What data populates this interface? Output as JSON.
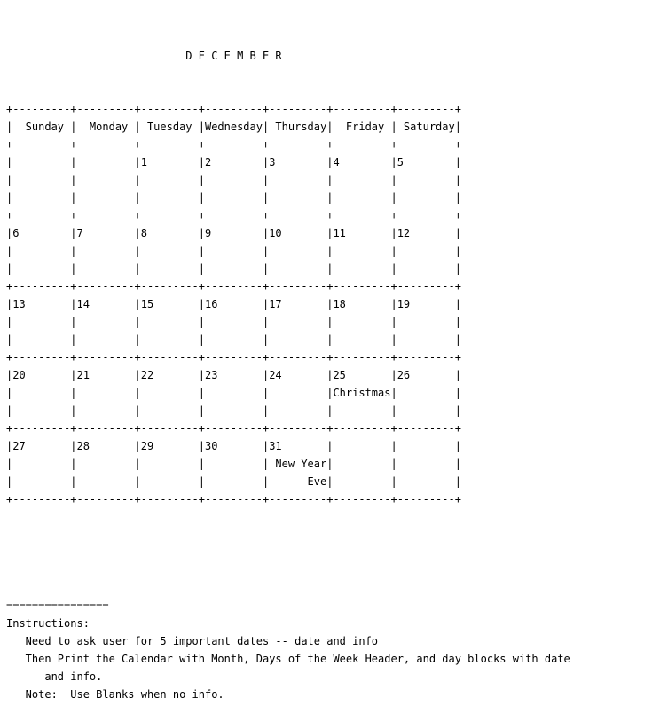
{
  "meta": {
    "output_type": "monospace-text-console",
    "text_color": "#000000",
    "background_color": "#ffffff"
  },
  "calendar": {
    "month_title": "D E C E M B E R",
    "cell_width_chars": 10,
    "columns": 7,
    "day_headers": [
      "Sunday",
      "Monday",
      "Tuesday",
      "Wednesday",
      "Thursday",
      "Friday",
      "Saturday"
    ],
    "border_row": "+---------+---------+---------+---------+---------+---------+---------+",
    "weeks": [
      {
        "index": 1,
        "cells": [
          {
            "date": "",
            "info": []
          },
          {
            "date": "",
            "info": []
          },
          {
            "date": "1",
            "info": []
          },
          {
            "date": "2",
            "info": []
          },
          {
            "date": "3",
            "info": []
          },
          {
            "date": "4",
            "info": []
          },
          {
            "date": "5",
            "info": []
          }
        ]
      },
      {
        "index": 2,
        "cells": [
          {
            "date": "6",
            "info": []
          },
          {
            "date": "7",
            "info": []
          },
          {
            "date": "8",
            "info": []
          },
          {
            "date": "9",
            "info": []
          },
          {
            "date": "10",
            "info": []
          },
          {
            "date": "11",
            "info": []
          },
          {
            "date": "12",
            "info": []
          }
        ]
      },
      {
        "index": 3,
        "cells": [
          {
            "date": "13",
            "info": []
          },
          {
            "date": "14",
            "info": []
          },
          {
            "date": "15",
            "info": []
          },
          {
            "date": "16",
            "info": []
          },
          {
            "date": "17",
            "info": []
          },
          {
            "date": "18",
            "info": []
          },
          {
            "date": "19",
            "info": []
          }
        ]
      },
      {
        "index": 4,
        "cells": [
          {
            "date": "20",
            "info": []
          },
          {
            "date": "21",
            "info": []
          },
          {
            "date": "22",
            "info": []
          },
          {
            "date": "23",
            "info": []
          },
          {
            "date": "24",
            "info": []
          },
          {
            "date": "25",
            "info": [
              "Christmas"
            ]
          },
          {
            "date": "26",
            "info": []
          }
        ]
      },
      {
        "index": 5,
        "cells": [
          {
            "date": "27",
            "info": []
          },
          {
            "date": "28",
            "info": []
          },
          {
            "date": "29",
            "info": []
          },
          {
            "date": "30",
            "info": []
          },
          {
            "date": "31",
            "info": [
              " New Years",
              "      Eve"
            ]
          },
          {
            "date": "",
            "info": []
          },
          {
            "date": "",
            "info": []
          }
        ]
      }
    ]
  },
  "instructions": {
    "separator": "================",
    "heading": "Instructions:",
    "lines": [
      "   Need to ask user for 5 important dates -- date and info",
      "   Then Print the Calendar with Month, Days of the Week Header, and day blocks with date",
      "      and info.",
      "   Note:  Use Blanks when no info."
    ]
  }
}
